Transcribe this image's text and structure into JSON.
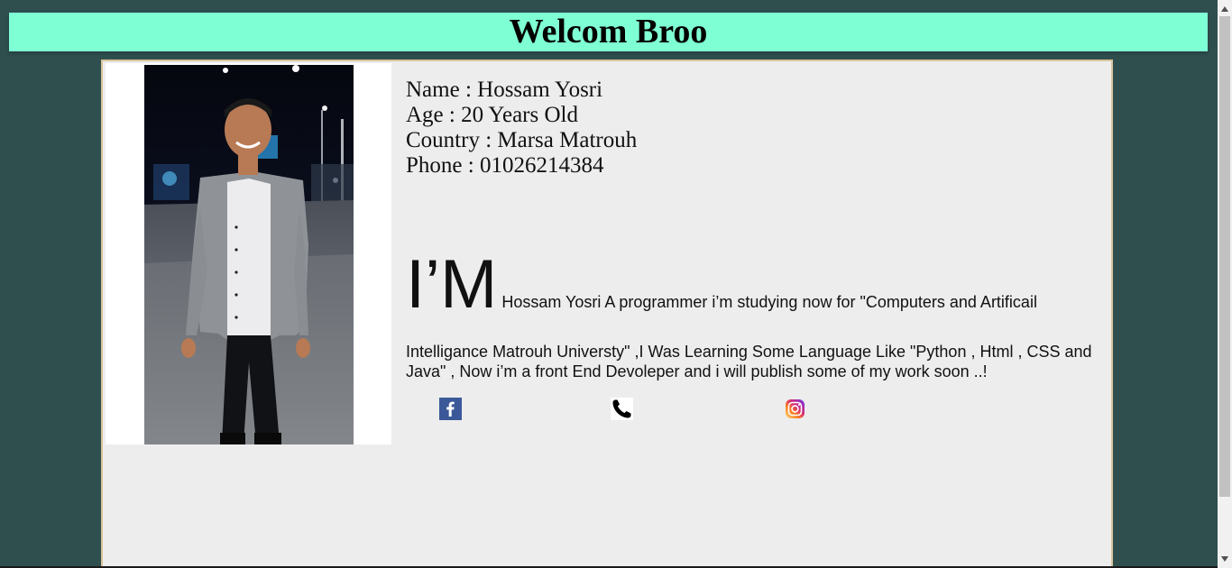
{
  "header": {
    "title": "Welcom Broo",
    "background_color": "#7fffd4"
  },
  "profile": {
    "name_line": "Name : Hossam Yosri",
    "age_line": "Age : 20 Years Old",
    "country_line": "Country : Marsa Matrouh",
    "phone_line": "Phone : 01026214384"
  },
  "about": {
    "lead": "I’M",
    "line1": " Hossam Yosri A programmer i’m studying now for \"Computers and Artificail",
    "rest": "Intelligance Matrouh Universty\" ,I Was Learning Some Language Like \"Python , Html , CSS and Java\" , Now i’m a front End Devoleper and i will publish some of my work soon ..!"
  },
  "social": {
    "icons": [
      "facebook-icon",
      "phone-icon",
      "instagram-icon"
    ]
  },
  "colors": {
    "page_background": "#2f4f4f",
    "card_background": "#ededed",
    "card_border": "#d9c39a"
  }
}
